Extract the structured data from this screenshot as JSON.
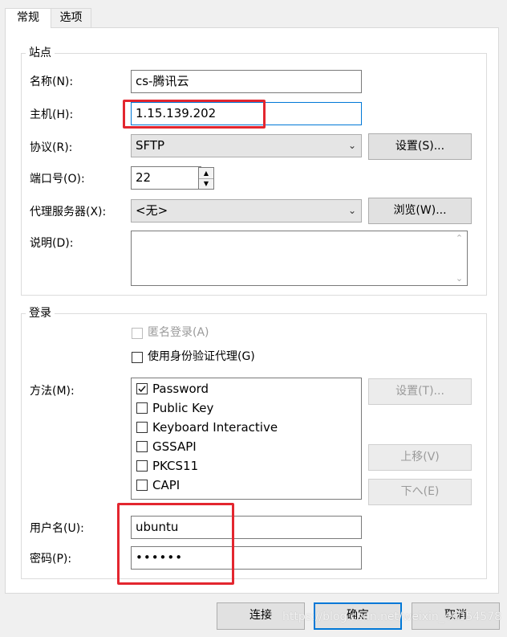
{
  "tabs": [
    {
      "label": "常规",
      "active": true
    },
    {
      "label": "选项",
      "active": false
    }
  ],
  "site_group": {
    "title": "站点",
    "name": {
      "label": "名称(N):",
      "value": "cs-腾讯云"
    },
    "host": {
      "label": "主机(H):",
      "value": "1.15.139.202"
    },
    "protocol": {
      "label": "协议(R):",
      "value": "SFTP",
      "settings_button": "设置(S)..."
    },
    "port": {
      "label": "端口号(O):",
      "value": "22"
    },
    "proxy": {
      "label": "代理服务器(X):",
      "value": "<无>",
      "browse_button": "浏览(W)..."
    },
    "description": {
      "label": "说明(D):",
      "value": ""
    }
  },
  "login_group": {
    "title": "登录",
    "anonymous": {
      "label": "匿名登录(A)",
      "checked": false,
      "disabled": true
    },
    "agent": {
      "label": "使用身份验证代理(G)",
      "checked": false
    },
    "method": {
      "label": "方法(M):",
      "options": [
        {
          "label": "Password",
          "checked": true
        },
        {
          "label": "Public Key",
          "checked": false
        },
        {
          "label": "Keyboard Interactive",
          "checked": false
        },
        {
          "label": "GSSAPI",
          "checked": false
        },
        {
          "label": "PKCS11",
          "checked": false
        },
        {
          "label": "CAPI",
          "checked": false
        }
      ],
      "settings_button": "设置(T)...",
      "up_button": "上移(V)",
      "down_button": "下へ(E)"
    },
    "username": {
      "label": "用户名(U):",
      "value": "ubuntu"
    },
    "password": {
      "label": "密码(P):",
      "value": "••••••"
    }
  },
  "footer": {
    "connect_button": "连接",
    "ok_button": "确定",
    "cancel_button": "取消"
  },
  "watermark": "https://blog.csdn.net/weixin_46354578",
  "colors": {
    "highlight_box": "#e3262f",
    "focus_border": "#0078d7"
  }
}
